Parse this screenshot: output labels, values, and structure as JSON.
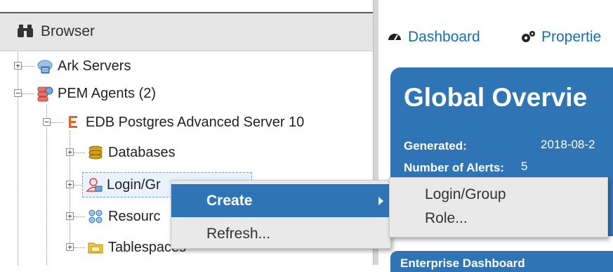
{
  "browser": {
    "title": "Browser",
    "tree": [
      {
        "label": "Ark Servers",
        "icon": "cloud-server-icon"
      },
      {
        "label": "PEM Agents (2)",
        "icon": "pem-agent-icon"
      },
      {
        "label": "EDB Postgres Advanced Server 10",
        "icon": "edb-icon"
      },
      {
        "label": "Databases",
        "icon": "database-icon"
      },
      {
        "label": "Login/Gr",
        "icon": "login-group-icon"
      },
      {
        "label": "Resourc",
        "icon": "resource-group-icon"
      },
      {
        "label": "Tablespaces",
        "icon": "tablespace-folder-icon"
      }
    ]
  },
  "right_pane": {
    "tabs": [
      {
        "label": "Dashboard",
        "icon": "dashboard-icon"
      },
      {
        "label": "Propertie",
        "icon": "properties-gear-icon"
      }
    ],
    "overview": {
      "title": "Global Overvie",
      "generated_label": "Generated:",
      "generated_value": "2018-08-2",
      "alerts_label": "Number of Alerts:",
      "alerts_value": "5"
    },
    "second_card_title": "Enterprise Dashboard"
  },
  "context_menu": {
    "items": [
      {
        "label": "Create",
        "active": true,
        "has_submenu": true
      },
      {
        "label": "Refresh...",
        "active": false
      }
    ],
    "submenu": {
      "line1": "Login/Group",
      "line2": "Role..."
    }
  },
  "colors": {
    "accent": "#2f75b6",
    "link": "#1a6db3",
    "header_bg": "#e6e6e6",
    "menu_bg": "#e9e9e9"
  }
}
